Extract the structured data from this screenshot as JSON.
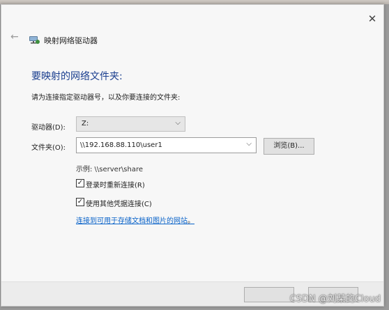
{
  "window": {
    "title": "映射网络驱动器",
    "close_glyph": "✕",
    "back_glyph": "←"
  },
  "main": {
    "heading": "要映射的网络文件夹:",
    "instruction": "请为连接指定驱动器号，以及你要连接的文件夹:",
    "drive": {
      "label": "驱动器(D):",
      "value": "Z:"
    },
    "folder": {
      "label": "文件夹(O):",
      "value": "\\\\192.168.88.110\\user1"
    },
    "browse_label": "浏览(B)...",
    "example": "示例: \\\\server\\share",
    "reconnect": {
      "label": "登录时重新连接(R)",
      "checked": true
    },
    "credentials": {
      "label": "使用其他凭据连接(C)",
      "checked": true
    },
    "link_text": "连接到可用于存储文档和图片的网站",
    "link_suffix": "。"
  },
  "watermark": "CSDN @刘某的Cloud",
  "colors": {
    "heading": "#1b3f8f",
    "link": "#0a63c9"
  }
}
